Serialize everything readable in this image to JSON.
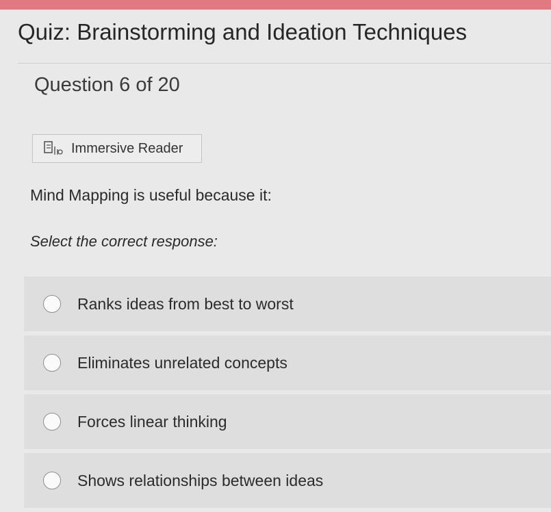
{
  "quiz": {
    "title": "Quiz: Brainstorming and Ideation Techniques",
    "question_counter": "Question 6 of 20",
    "immersive_reader_label": "Immersive Reader",
    "question_text": "Mind Mapping is useful because it:",
    "instruction": "Select the correct response:",
    "options": [
      {
        "label": "Ranks ideas from best to worst",
        "selected": false
      },
      {
        "label": "Eliminates unrelated concepts",
        "selected": false
      },
      {
        "label": "Forces linear thinking",
        "selected": false
      },
      {
        "label": "Shows relationships between ideas",
        "selected": false
      }
    ]
  },
  "colors": {
    "accent_bar": "#e07a80",
    "background": "#e9e9e9",
    "option_background": "#dedede"
  },
  "icons": {
    "immersive_reader": "immersive-reader-icon",
    "radio": "radio-unselected"
  }
}
